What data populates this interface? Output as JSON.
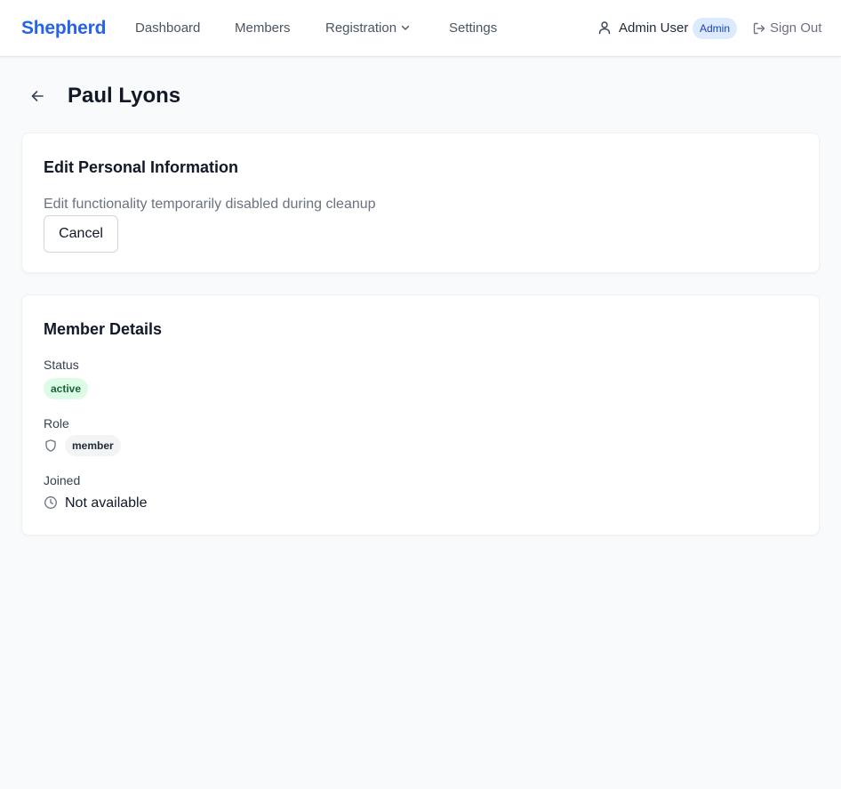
{
  "app": {
    "brand": "Shepherd",
    "accent_color": "#2563eb"
  },
  "nav": {
    "items": [
      {
        "label": "Dashboard"
      },
      {
        "label": "Members"
      },
      {
        "label": "Registration",
        "icon": "chevron-down-icon"
      },
      {
        "label": "Settings"
      }
    ]
  },
  "user": {
    "icon": "user-icon",
    "name": "Admin User",
    "role_badge": "Admin",
    "sign_out_icon": "sign-out-icon",
    "sign_out_label": "Sign Out"
  },
  "page": {
    "back_icon": "arrow-left-icon",
    "title": "Paul Lyons"
  },
  "edit_card": {
    "title": "Edit Personal Information",
    "note": "Edit functionality temporarily disabled during cleanup",
    "cancel_label": "Cancel"
  },
  "details_card": {
    "title": "Member Details",
    "status_label": "Status",
    "status_value": "active",
    "status_color": "#166534",
    "role_label": "Role",
    "role_icon": "shield-icon",
    "role_value": "member",
    "joined_label": "Joined",
    "joined_icon": "clock-icon",
    "joined_value": "Not available"
  }
}
